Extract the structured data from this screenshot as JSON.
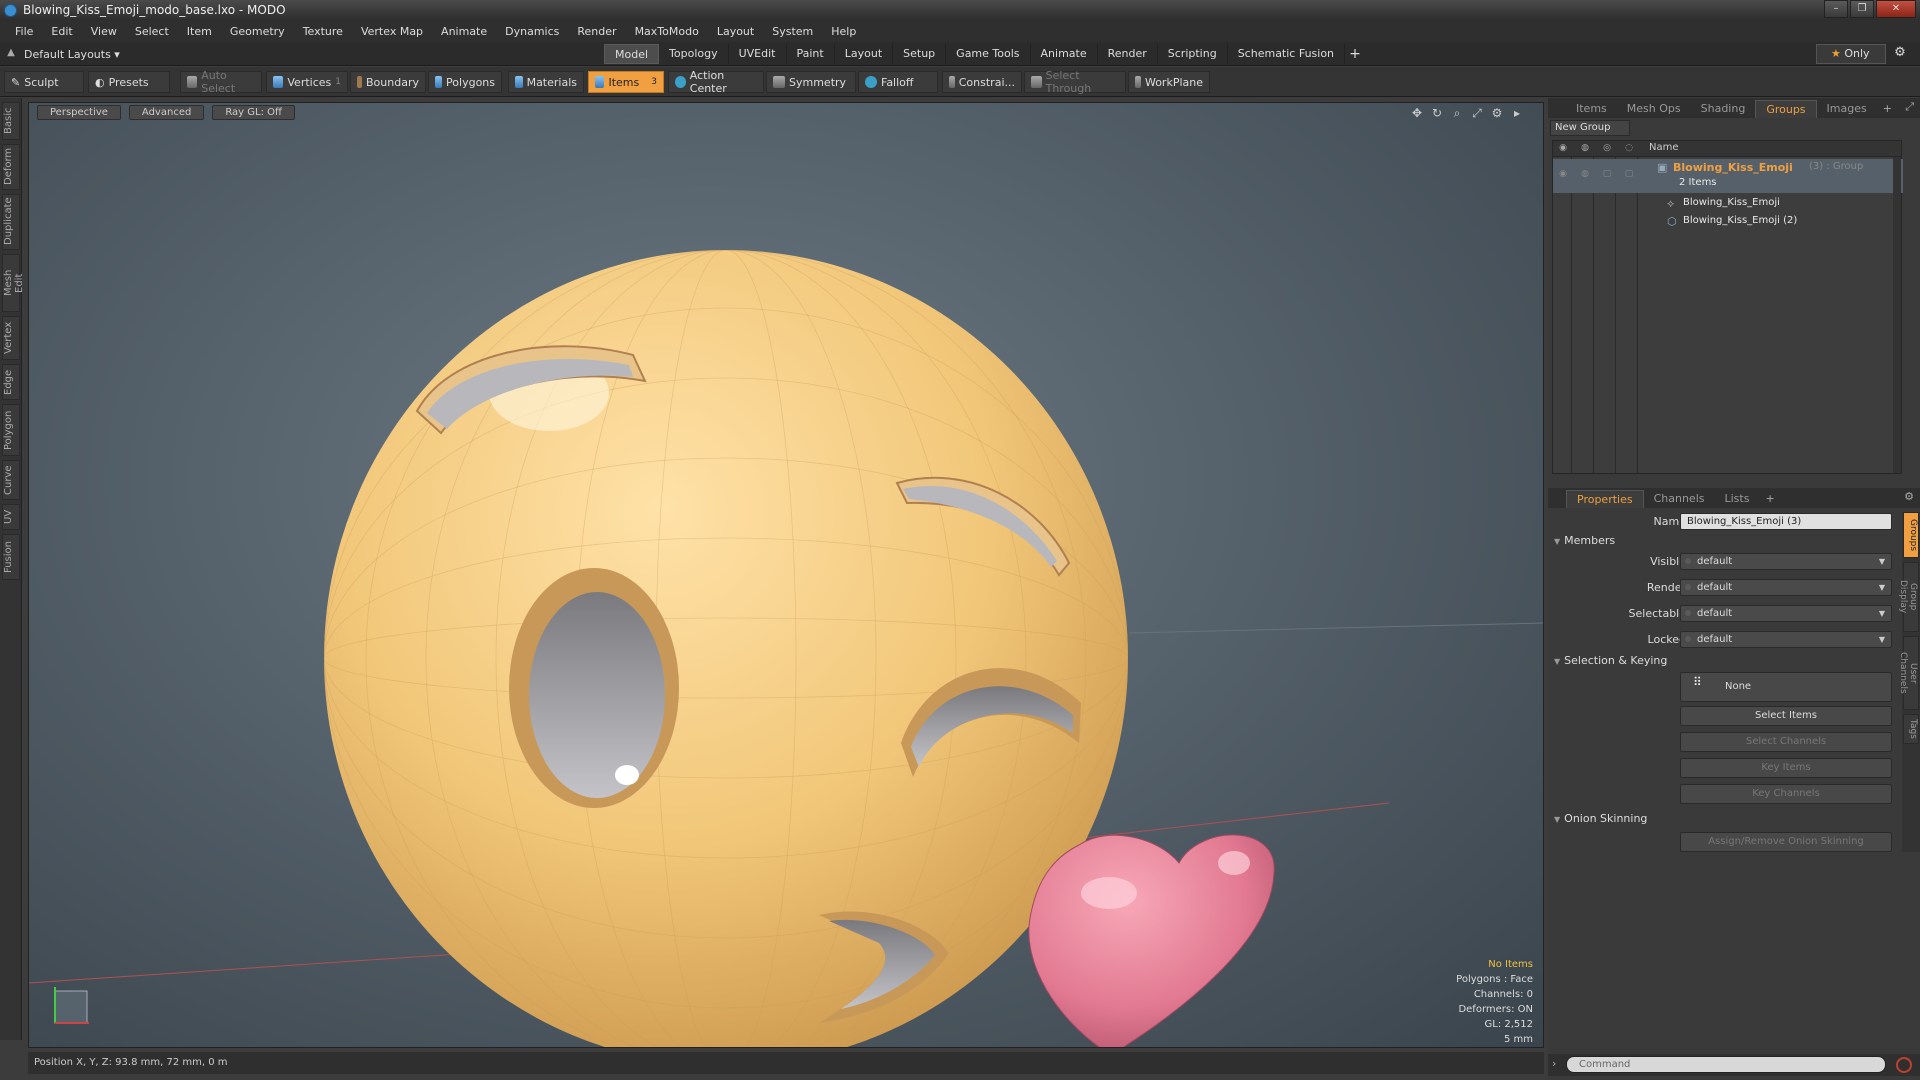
{
  "window": {
    "title": "Blowing_Kiss_Emoji_modo_base.lxo - MODO",
    "buttons": [
      "–",
      "❐",
      "✕"
    ]
  },
  "menu": [
    "File",
    "Edit",
    "View",
    "Select",
    "Item",
    "Geometry",
    "Texture",
    "Vertex Map",
    "Animate",
    "Dynamics",
    "Render",
    "MaxToModo",
    "Layout",
    "System",
    "Help"
  ],
  "layout": {
    "label": "Default Layouts ▾",
    "tabs": [
      "Model",
      "Topology",
      "UVEdit",
      "Paint",
      "Layout",
      "Setup",
      "Game Tools",
      "Animate",
      "Render",
      "Scripting",
      "Schematic Fusion"
    ],
    "active_tab": "Model",
    "plus": "+",
    "only": "Only",
    "only_star": "★"
  },
  "toolbar": {
    "sculpt": "Sculpt",
    "presets": "Presets",
    "auto_select": "Auto Select",
    "vertices": "Vertices",
    "vertices_count": "1",
    "boundary": "Boundary",
    "polygons": "Polygons",
    "materials": "Materials",
    "items": "Items",
    "items_count": "3",
    "action_center": "Action Center",
    "symmetry": "Symmetry",
    "falloff": "Falloff",
    "constraint": "Constrai...",
    "select_through": "Select Through",
    "workplane": "WorkPlane"
  },
  "left_tabs": [
    "Basic",
    "Deform",
    "Duplicate",
    "Mesh Edit",
    "Vertex",
    "Edge",
    "Polygon",
    "Curve",
    "UV",
    "Fusion"
  ],
  "viewport": {
    "perspective": "Perspective",
    "advanced": "Advanced",
    "raygl": "Ray GL: Off",
    "readout": {
      "items": "No Items",
      "polygons": "Polygons : Face",
      "channels": "Channels: 0",
      "deformers": "Deformers: ON",
      "gl": "GL: 2,512",
      "scale": "5 mm"
    }
  },
  "status": {
    "position": "Position X, Y, Z:  93.8 mm, 72 mm, 0 m"
  },
  "groups_panel": {
    "tabs": [
      "Items",
      "Mesh Ops",
      "Shading",
      "Groups",
      "Images"
    ],
    "active": "Groups",
    "new_group": "New Group",
    "col_name": "Name",
    "group_name": "Blowing_Kiss_Emoji",
    "group_suffix": "(3) : Group",
    "items_count": "2 Items",
    "children": [
      "Blowing_Kiss_Emoji",
      "Blowing_Kiss_Emoji (2)"
    ]
  },
  "properties": {
    "tabs": [
      "Properties",
      "Channels",
      "Lists"
    ],
    "active": "Properties",
    "name_label": "Name",
    "name_value": "Blowing_Kiss_Emoji (3)",
    "members": "Members",
    "visible_label": "Visible",
    "visible": "default",
    "render_label": "Render",
    "render": "default",
    "selectable_label": "Selectable",
    "selectable": "default",
    "locked_label": "Locked",
    "locked": "default",
    "sel_keying": "Selection & Keying",
    "none": "None",
    "select_items": "Select Items",
    "select_channels": "Select Channels",
    "key_items": "Key Items",
    "key_channels": "Key Channels",
    "onion": "Onion Skinning",
    "assign_onion": "Assign/Remove Onion Skinning"
  },
  "side_tabs": [
    "Groups",
    "Group Display",
    "User Channels",
    "Tags"
  ],
  "command": {
    "placeholder": "Command"
  },
  "colors": {
    "accent": "#f0a040",
    "face": "#f0c878",
    "heart": "#e87890"
  }
}
